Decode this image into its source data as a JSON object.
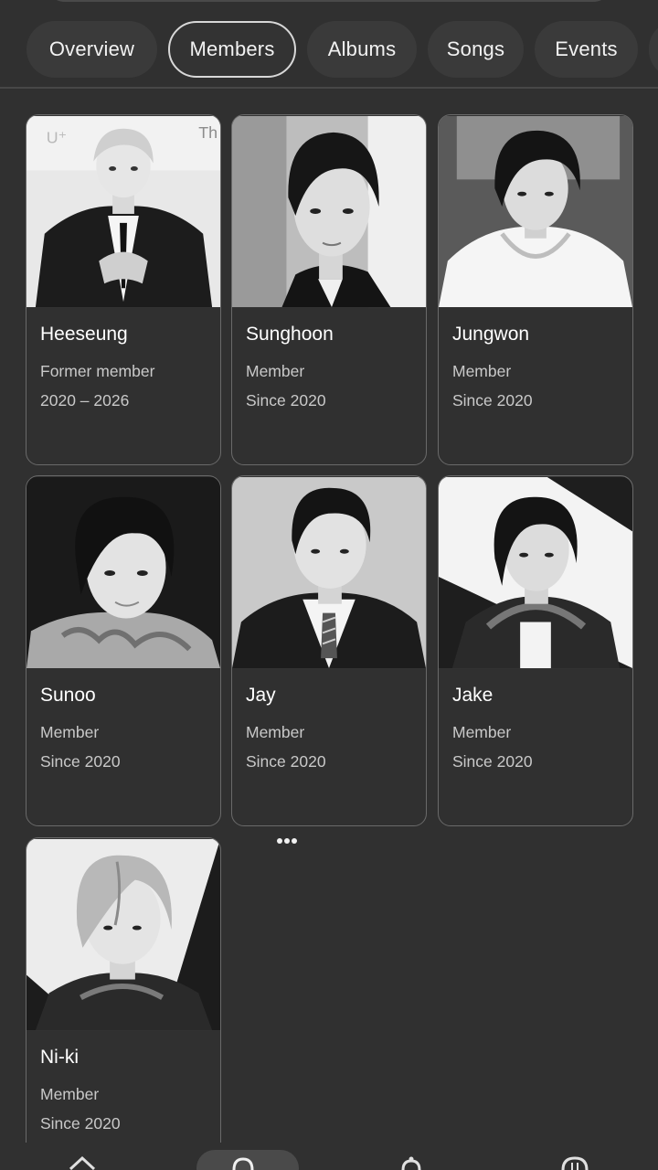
{
  "tabs": [
    {
      "label": "Overview"
    },
    {
      "label": "Members"
    },
    {
      "label": "Albums"
    },
    {
      "label": "Songs"
    },
    {
      "label": "Events"
    }
  ],
  "members": [
    {
      "name": "Heeseung",
      "role": "Former member",
      "years": "2020 – 2026"
    },
    {
      "name": "Sunghoon",
      "role": "Member",
      "years": "Since 2020"
    },
    {
      "name": "Jungwon",
      "role": "Member",
      "years": "Since 2020"
    },
    {
      "name": "Sunoo",
      "role": "Member",
      "years": "Since 2020"
    },
    {
      "name": "Jay",
      "role": "Member",
      "years": "Since 2020"
    },
    {
      "name": "Jake",
      "role": "Member",
      "years": "Since 2020"
    },
    {
      "name": "Ni-ki",
      "role": "Member",
      "years": "Since 2020"
    }
  ],
  "bottom_nav": [
    {
      "icon": "home-icon"
    },
    {
      "icon": "search-icon",
      "selected": true
    },
    {
      "icon": "notifications-icon"
    },
    {
      "icon": "saved-icon"
    }
  ]
}
